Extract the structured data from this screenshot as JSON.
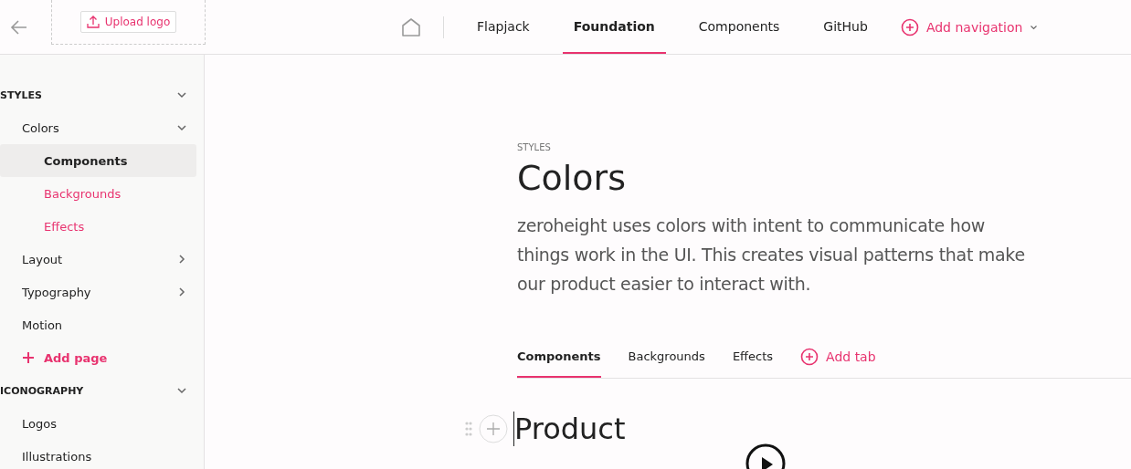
{
  "header": {
    "upload_button": "Upload logo",
    "nav": [
      {
        "label": "Flapjack",
        "selected": false
      },
      {
        "label": "Foundation",
        "selected": true
      },
      {
        "label": "Components",
        "selected": false
      },
      {
        "label": "GitHub",
        "selected": false
      }
    ],
    "add_navigation": "Add navigation"
  },
  "sidebar": {
    "sections": [
      {
        "label": "STYLES",
        "expanded": true,
        "items": [
          {
            "label": "Colors",
            "expanded": true,
            "children": [
              {
                "label": "Components",
                "selected": true,
                "unpublished": false
              },
              {
                "label": "Backgrounds",
                "selected": false,
                "unpublished": true
              },
              {
                "label": "Effects",
                "selected": false,
                "unpublished": true
              }
            ]
          },
          {
            "label": "Layout",
            "expanded": false,
            "has_children": true
          },
          {
            "label": "Typography",
            "expanded": false,
            "has_children": true
          },
          {
            "label": "Motion",
            "has_children": false
          }
        ],
        "add_page": "Add page"
      },
      {
        "label": "ICONOGRAPHY",
        "expanded": true,
        "items": [
          {
            "label": "Logos",
            "has_children": false
          },
          {
            "label": "Illustrations",
            "has_children": false
          }
        ]
      }
    ]
  },
  "page": {
    "eyebrow": "STYLES",
    "title": "Colors",
    "intro": "zeroheight uses colors with intent to communicate how things work in the UI. This creates visual patterns that make our product easier to interact with.",
    "tabs": [
      {
        "label": "Components",
        "selected": true
      },
      {
        "label": "Backgrounds",
        "selected": false
      },
      {
        "label": "Effects",
        "selected": false
      }
    ],
    "add_tab": "Add tab",
    "heading": "Product"
  }
}
